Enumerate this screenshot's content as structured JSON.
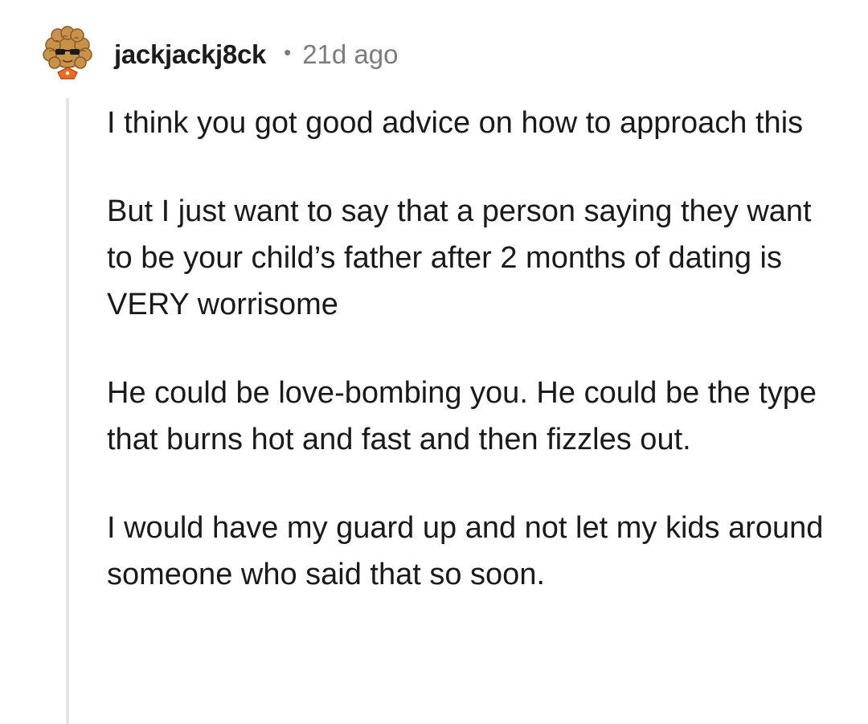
{
  "comment": {
    "author": "jackjackj8ck",
    "separator": "•",
    "timestamp": "21d ago",
    "paragraphs": [
      "I think you got good advice on how to approach this",
      "But I just want to say that a person saying they want to be your child’s father after 2 months of dating is VERY worrisome",
      "He could be love-bombing you. He could be the type that burns hot and fast and then fizzles out.",
      "I would have my guard up and not let my kids around someone who said that so soon."
    ]
  }
}
